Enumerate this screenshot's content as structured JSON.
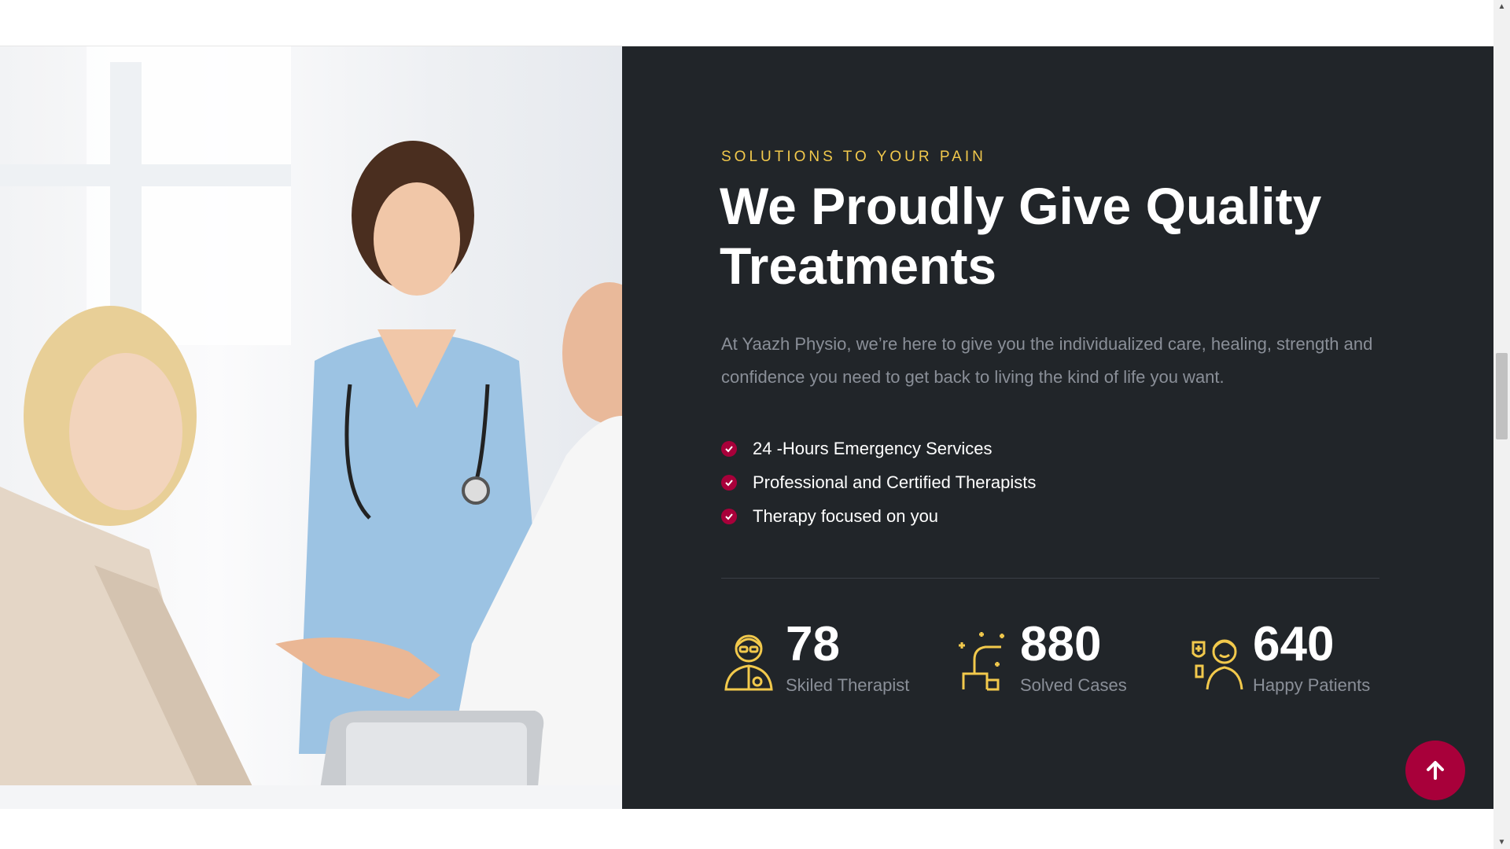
{
  "section": {
    "eyebrow": "SOLUTIONS TO YOUR PAIN",
    "title": "We Proudly Give Quality Treatments",
    "lead": "At Yaazh Physio, we’re here to give you the individualized care, healing, strength and confidence you need to get back to living the kind of life you want.",
    "features": [
      "24 -Hours Emergency Services",
      "Professional and Certified Therapists",
      "Therapy focused on you"
    ]
  },
  "stats": [
    {
      "value": "78",
      "label": "Skiled Therapist",
      "icon": "therapist-icon"
    },
    {
      "value": "880",
      "label": "Solved Cases",
      "icon": "solved-cases-icon"
    },
    {
      "value": "640",
      "label": "Happy Patients",
      "icon": "happy-patients-icon"
    }
  ],
  "colors": {
    "accent": "#a8003a",
    "eyebrow": "#f2c94c",
    "panel": "#212529",
    "muted": "#8a8f98"
  },
  "image": {
    "description_icon": "doctors-consultation-photo"
  }
}
